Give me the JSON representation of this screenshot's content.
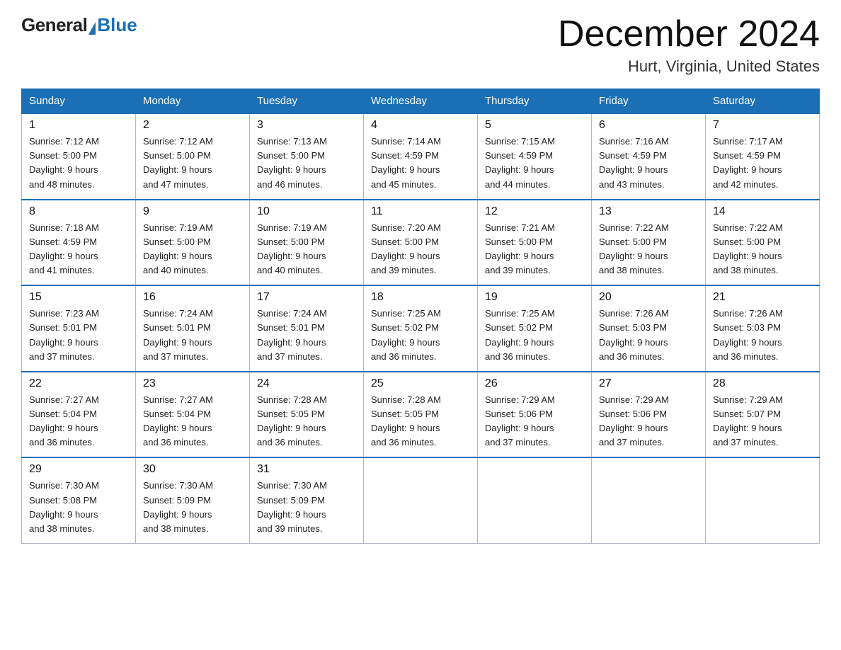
{
  "logo": {
    "general": "General",
    "blue": "Blue"
  },
  "title": "December 2024",
  "location": "Hurt, Virginia, United States",
  "days_header": [
    "Sunday",
    "Monday",
    "Tuesday",
    "Wednesday",
    "Thursday",
    "Friday",
    "Saturday"
  ],
  "weeks": [
    [
      {
        "num": "1",
        "sunrise": "7:12 AM",
        "sunset": "5:00 PM",
        "daylight": "9 hours and 48 minutes."
      },
      {
        "num": "2",
        "sunrise": "7:12 AM",
        "sunset": "5:00 PM",
        "daylight": "9 hours and 47 minutes."
      },
      {
        "num": "3",
        "sunrise": "7:13 AM",
        "sunset": "5:00 PM",
        "daylight": "9 hours and 46 minutes."
      },
      {
        "num": "4",
        "sunrise": "7:14 AM",
        "sunset": "4:59 PM",
        "daylight": "9 hours and 45 minutes."
      },
      {
        "num": "5",
        "sunrise": "7:15 AM",
        "sunset": "4:59 PM",
        "daylight": "9 hours and 44 minutes."
      },
      {
        "num": "6",
        "sunrise": "7:16 AM",
        "sunset": "4:59 PM",
        "daylight": "9 hours and 43 minutes."
      },
      {
        "num": "7",
        "sunrise": "7:17 AM",
        "sunset": "4:59 PM",
        "daylight": "9 hours and 42 minutes."
      }
    ],
    [
      {
        "num": "8",
        "sunrise": "7:18 AM",
        "sunset": "4:59 PM",
        "daylight": "9 hours and 41 minutes."
      },
      {
        "num": "9",
        "sunrise": "7:19 AM",
        "sunset": "5:00 PM",
        "daylight": "9 hours and 40 minutes."
      },
      {
        "num": "10",
        "sunrise": "7:19 AM",
        "sunset": "5:00 PM",
        "daylight": "9 hours and 40 minutes."
      },
      {
        "num": "11",
        "sunrise": "7:20 AM",
        "sunset": "5:00 PM",
        "daylight": "9 hours and 39 minutes."
      },
      {
        "num": "12",
        "sunrise": "7:21 AM",
        "sunset": "5:00 PM",
        "daylight": "9 hours and 39 minutes."
      },
      {
        "num": "13",
        "sunrise": "7:22 AM",
        "sunset": "5:00 PM",
        "daylight": "9 hours and 38 minutes."
      },
      {
        "num": "14",
        "sunrise": "7:22 AM",
        "sunset": "5:00 PM",
        "daylight": "9 hours and 38 minutes."
      }
    ],
    [
      {
        "num": "15",
        "sunrise": "7:23 AM",
        "sunset": "5:01 PM",
        "daylight": "9 hours and 37 minutes."
      },
      {
        "num": "16",
        "sunrise": "7:24 AM",
        "sunset": "5:01 PM",
        "daylight": "9 hours and 37 minutes."
      },
      {
        "num": "17",
        "sunrise": "7:24 AM",
        "sunset": "5:01 PM",
        "daylight": "9 hours and 37 minutes."
      },
      {
        "num": "18",
        "sunrise": "7:25 AM",
        "sunset": "5:02 PM",
        "daylight": "9 hours and 36 minutes."
      },
      {
        "num": "19",
        "sunrise": "7:25 AM",
        "sunset": "5:02 PM",
        "daylight": "9 hours and 36 minutes."
      },
      {
        "num": "20",
        "sunrise": "7:26 AM",
        "sunset": "5:03 PM",
        "daylight": "9 hours and 36 minutes."
      },
      {
        "num": "21",
        "sunrise": "7:26 AM",
        "sunset": "5:03 PM",
        "daylight": "9 hours and 36 minutes."
      }
    ],
    [
      {
        "num": "22",
        "sunrise": "7:27 AM",
        "sunset": "5:04 PM",
        "daylight": "9 hours and 36 minutes."
      },
      {
        "num": "23",
        "sunrise": "7:27 AM",
        "sunset": "5:04 PM",
        "daylight": "9 hours and 36 minutes."
      },
      {
        "num": "24",
        "sunrise": "7:28 AM",
        "sunset": "5:05 PM",
        "daylight": "9 hours and 36 minutes."
      },
      {
        "num": "25",
        "sunrise": "7:28 AM",
        "sunset": "5:05 PM",
        "daylight": "9 hours and 36 minutes."
      },
      {
        "num": "26",
        "sunrise": "7:29 AM",
        "sunset": "5:06 PM",
        "daylight": "9 hours and 37 minutes."
      },
      {
        "num": "27",
        "sunrise": "7:29 AM",
        "sunset": "5:06 PM",
        "daylight": "9 hours and 37 minutes."
      },
      {
        "num": "28",
        "sunrise": "7:29 AM",
        "sunset": "5:07 PM",
        "daylight": "9 hours and 37 minutes."
      }
    ],
    [
      {
        "num": "29",
        "sunrise": "7:30 AM",
        "sunset": "5:08 PM",
        "daylight": "9 hours and 38 minutes."
      },
      {
        "num": "30",
        "sunrise": "7:30 AM",
        "sunset": "5:09 PM",
        "daylight": "9 hours and 38 minutes."
      },
      {
        "num": "31",
        "sunrise": "7:30 AM",
        "sunset": "5:09 PM",
        "daylight": "9 hours and 39 minutes."
      },
      null,
      null,
      null,
      null
    ]
  ]
}
